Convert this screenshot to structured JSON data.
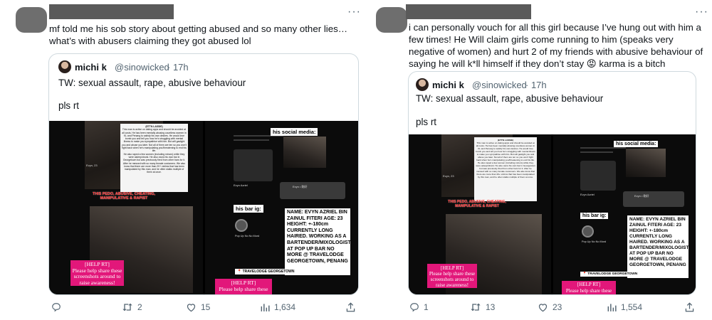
{
  "left": {
    "body": "mf told me his sob story about getting abused and so many other lies…  what’s with abusers claiming they got abused lol",
    "quote": {
      "name": "michi k",
      "handle": "@sinowicked",
      "time": "· 17h",
      "tw": "TW: sexual assault, rape, abusive behaviour",
      "plsrt": "pls rt"
    },
    "counts": {
      "replies": "",
      "reposts": "2",
      "likes": "15",
      "views": "1,634"
    }
  },
  "right": {
    "body": "i can personally vouch for all this girl because I’ve hung out with him a few times! He Will claim girls come running to him (speaks very negative of women) and hurt 2 of my friends with abusive behaviour of saying he will k*ll himself if they don’t stay 😡 karma is a bitch",
    "quote": {
      "name": "michi k",
      "handle": "@sinowicked",
      "time": "· 17h",
      "tw": "TW: sexual assault, rape, abusive behaviour",
      "plsrt": "pls rt"
    },
    "counts": {
      "replies": "1",
      "reposts": "13",
      "likes": "23",
      "views": "1,554"
    }
  },
  "media": {
    "notice_title": "(ETTN LASSIE)",
    "notice_body": "This man is active on dating apps and should be avoided at all costs. He has been mentally abusing countless women in KL and Penang to satisfy his own desires. He would love bomb you and tell you how he's struggling with mental illness to make you sympathise with him. But will gaslight you and abuse you later. Not all of them are ten so you won't fight back when he's manipulating you/threatening to end his life.",
    "notice_body2": "He also raped a few women (including minors) while they were asleep/drunk. He also owns his own bar in Georgetown but was previously fired from other bars for it. After he messed with so many female customers. We also know that there are more than 20+ victims that has been manipulated by this man, and he often stalks multiple of them at once.",
    "red_text": "THIS PEDO, ABUSIVE, CHEATING, MANIPULATIVE & RAPIST",
    "banner": "[HELP RT]",
    "banner2": "Please help share these screenshots around to raise awareness!",
    "banner_short": "Please help share these",
    "profile_name": "Evyn, 23",
    "insta_name": "Evyn Azriel",
    "social_label": "his social media:",
    "bar_label": "his bar ig:",
    "evyn_tag": "Evyn • 剛好",
    "details": "NAME: EVYN AZRIEL BIN ZAINUL FITERI AGE: 23 HEIGHT: +-180cm CURRENTLY LONG HAIRED. WORKING AS A BARTENDER/MIXOLOGIST AT POP UP BAR NO MORE @ TRAVELODGE GEORGETOWN, PENANG",
    "venue": "Pop Up No No Mord",
    "location_tag": "📍 TRAVELODGE GEORGETOWN"
  }
}
